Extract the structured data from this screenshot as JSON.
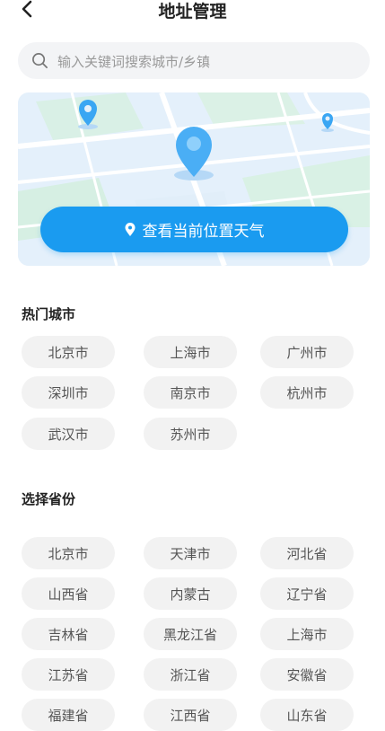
{
  "header": {
    "title": "地址管理"
  },
  "search": {
    "placeholder": "输入关键词搜索城市/乡镇"
  },
  "map": {
    "button_label": "查看当前位置天气",
    "accent": "#1a9bf0"
  },
  "hot": {
    "title": "热门城市",
    "cities": [
      "北京市",
      "上海市",
      "广州市",
      "深圳市",
      "南京市",
      "杭州市",
      "武汉市",
      "苏州市"
    ]
  },
  "provinces": {
    "title": "选择省份",
    "items": [
      "北京市",
      "天津市",
      "河北省",
      "山西省",
      "内蒙古",
      "辽宁省",
      "吉林省",
      "黑龙江省",
      "上海市",
      "江苏省",
      "浙江省",
      "安徽省",
      "福建省",
      "江西省",
      "山东省"
    ]
  }
}
